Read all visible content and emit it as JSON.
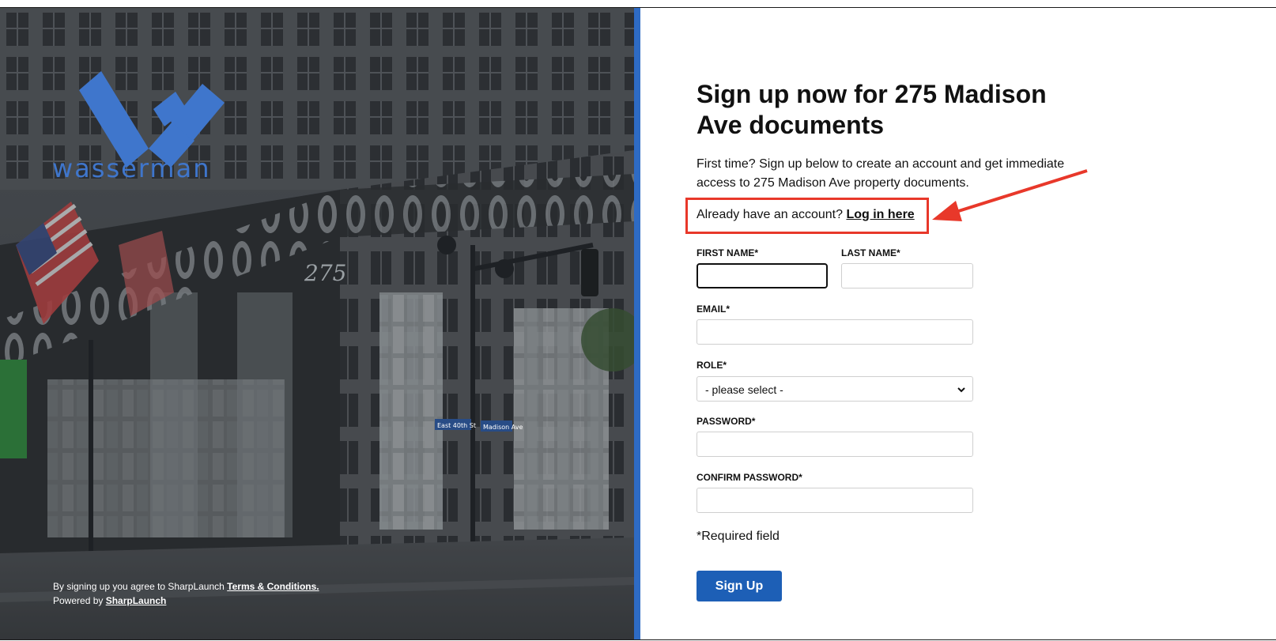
{
  "brand": {
    "logo_text": "wasserman",
    "accent_color": "#2e6bc4",
    "logo_color": "#3f76cc"
  },
  "hero": {
    "address_numeral": "275",
    "street_sign_1": "East 40th St",
    "street_sign_2": "Madison Ave",
    "footer": {
      "agree_prefix": "By signing up you agree to SharpLaunch ",
      "terms_link": "Terms & Conditions.",
      "powered_prefix": "Powered by ",
      "powered_link": "SharpLaunch"
    }
  },
  "form": {
    "title": "Sign up now for 275 Madison Ave documents",
    "intro": "First time? Sign up below to create an account and get immediate access to 275 Madison Ave property documents.",
    "login_prompt": "Already have an account? ",
    "login_link": "Log in here",
    "highlight_color": "#e8382a",
    "fields": {
      "first_name": {
        "label": "FIRST NAME*",
        "value": ""
      },
      "last_name": {
        "label": "LAST NAME*",
        "value": ""
      },
      "email": {
        "label": "EMAIL*",
        "value": ""
      },
      "role": {
        "label": "ROLE*",
        "selected": "- please select -"
      },
      "password": {
        "label": "PASSWORD*",
        "value": ""
      },
      "confirm_password": {
        "label": "CONFIRM PASSWORD*",
        "value": ""
      }
    },
    "required_note": "*Required field",
    "submit_label": "Sign Up",
    "submit_color": "#1d5fb6"
  }
}
